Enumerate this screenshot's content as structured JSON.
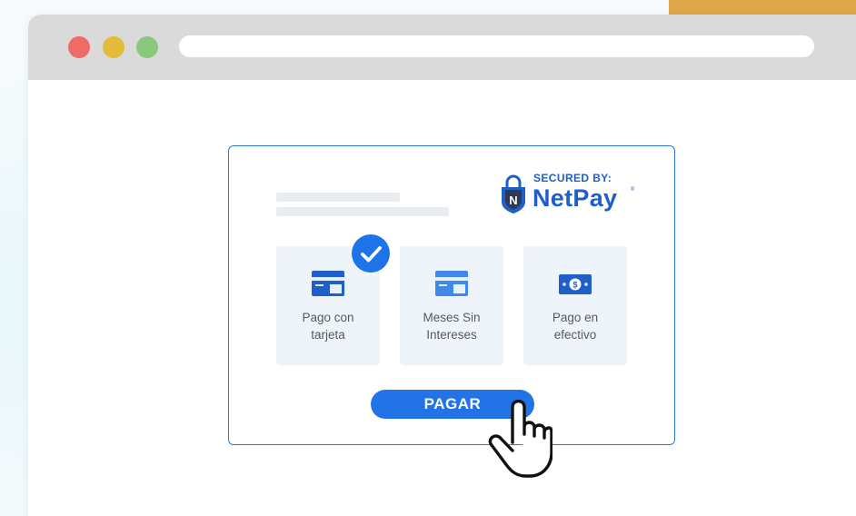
{
  "browser": {
    "window_controls": [
      "close",
      "minimize",
      "maximize"
    ],
    "url": ""
  },
  "payment": {
    "brand": {
      "secured_label": "SECURED BY:",
      "name": "NetPay",
      "registered_mark": "®",
      "shield_letter": "N"
    },
    "options": [
      {
        "line1": "Pago con",
        "line2": "tarjeta",
        "icon": "credit-card-icon",
        "selected": true
      },
      {
        "line1": "Meses Sin",
        "line2": "Intereses",
        "icon": "credit-card-icon",
        "selected": false
      },
      {
        "line1": "Pago en",
        "line2": "efectivo",
        "icon": "cash-bill-icon",
        "selected": false
      }
    ],
    "pay_button_label": "PAGAR"
  },
  "colors": {
    "primary": "#2173e6",
    "brand": "#1f5fc9",
    "accent": "#e0a64a",
    "option_bg": "#eff4fb"
  }
}
